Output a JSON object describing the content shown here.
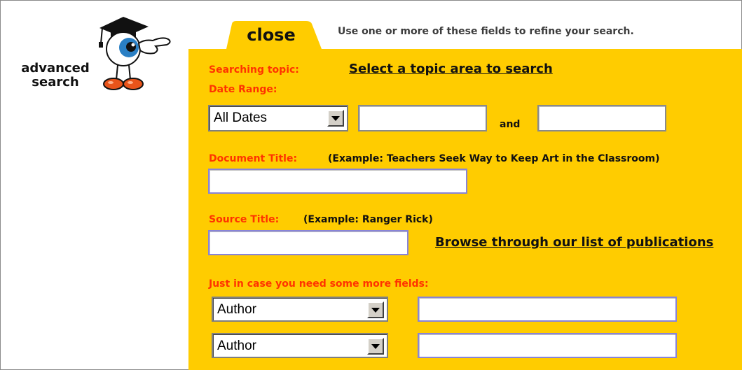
{
  "logo": {
    "line1": "advanced",
    "line2": "search",
    "mascot_icon": "eyeball-graduate-mascot-icon"
  },
  "tab": {
    "label": "close"
  },
  "hint": "Use one or more of these fields to refine your search.",
  "form": {
    "topic_label": "Searching topic:",
    "topic_link": "Select a topic area to search",
    "date_label": "Date Range:",
    "date_select_value": "All Dates",
    "date_and": "and",
    "date_from_value": "",
    "date_to_value": "",
    "doc_title_label": "Document Title:",
    "doc_title_example": "(Example: Teachers Seek Way to Keep Art in the Classroom)",
    "doc_title_value": "",
    "source_title_label": "Source Title:",
    "source_title_example": "(Example: Ranger Rick)",
    "source_title_value": "",
    "browse_link": "Browse through our list of publications",
    "more_fields_label": "Just in case you need some more fields:",
    "extra_fields": [
      {
        "field": "Author",
        "value": ""
      },
      {
        "field": "Author",
        "value": ""
      }
    ]
  },
  "colors": {
    "panel": "#ffcc00",
    "label_red": "#ff3300",
    "mascot_iris": "#2a7fc4",
    "mascot_shoes": "#e8541a"
  }
}
